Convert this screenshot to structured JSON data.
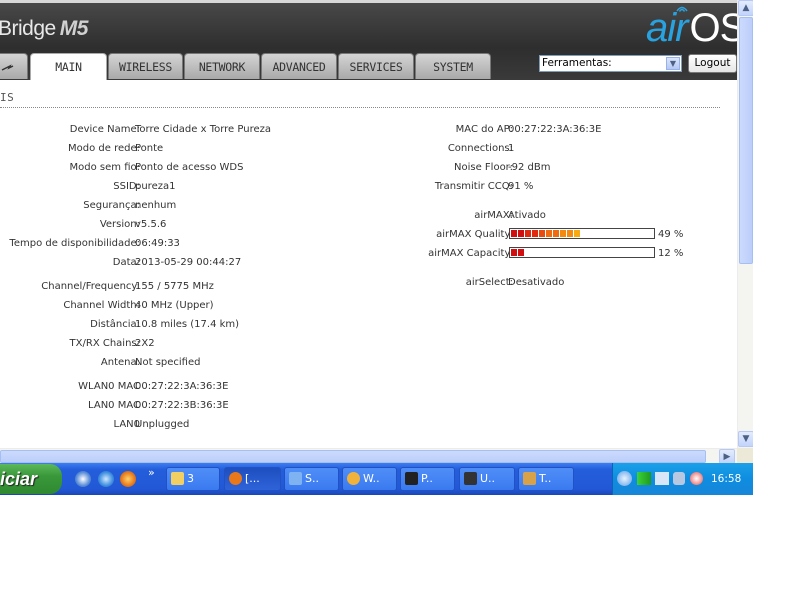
{
  "header": {
    "product_name": "Bridge",
    "product_model": "M5",
    "logo_air": "air",
    "logo_os": "OS"
  },
  "tabs": [
    {
      "label": "MAIN",
      "active": true
    },
    {
      "label": "WIRELESS"
    },
    {
      "label": "NETWORK"
    },
    {
      "label": "ADVANCED"
    },
    {
      "label": "SERVICES"
    },
    {
      "label": "SYSTEM"
    }
  ],
  "toolbar": {
    "tools_selected": "Ferramentas:",
    "logout_label": "Logout"
  },
  "section": {
    "title": "IS"
  },
  "status_left": [
    {
      "label": "Device Name:",
      "value": "Torre Cidade x Torre Pureza"
    },
    {
      "label": "Modo de rede:",
      "value": "Ponte"
    },
    {
      "label": "Modo sem fio:",
      "value": "Ponto de acesso WDS"
    },
    {
      "label": "SSID:",
      "value": "pureza1"
    },
    {
      "label": "Segurança:",
      "value": "nenhum"
    },
    {
      "label": "Version:",
      "value": "v5.5.6"
    },
    {
      "label": "Tempo de disponibilidade:",
      "value": "06:49:33"
    },
    {
      "label": "Data:",
      "value": "2013-05-29 00:44:27"
    },
    {
      "label": "Channel/Frequency:",
      "value": "155 / 5775 MHz"
    },
    {
      "label": "Channel Width:",
      "value": "40 MHz (Upper)"
    },
    {
      "label": "Distância:",
      "value": "10.8 miles (17.4 km)"
    },
    {
      "label": "TX/RX Chains:",
      "value": "2X2"
    },
    {
      "label": "Antena:",
      "value": "Not specified"
    },
    {
      "label": "WLAN0 MAC",
      "value": "00:27:22:3A:36:3E"
    },
    {
      "label": "LAN0 MAC",
      "value": "00:27:22:3B:36:3E"
    },
    {
      "label": "LAN0",
      "value": "Unplugged"
    }
  ],
  "status_right": [
    {
      "label": "MAC do AP:",
      "value": "00:27:22:3A:36:3E"
    },
    {
      "label": "Connections:",
      "value": "1"
    },
    {
      "label": "Noise Floor:",
      "value": "-92 dBm"
    },
    {
      "label": "Transmitir CCQ:",
      "value": "91 %"
    },
    {
      "label": "airMAX:",
      "value": "Ativado"
    },
    {
      "label": "airSelect:",
      "value": "Desativado"
    }
  ],
  "airmax_quality": {
    "label": "airMAX Quality:",
    "percent_text": "49 %",
    "percent": 49
  },
  "airmax_capacity": {
    "label": "airMAX Capacity:",
    "percent_text": "12 %",
    "percent": 12
  },
  "taskbar": {
    "start_label": "iciar",
    "overflow_chevron": "»",
    "tasks": [
      {
        "label": "3",
        "icon": "folder-icon"
      },
      {
        "label": "[...",
        "icon": "firefox-icon",
        "active": true
      },
      {
        "label": "S..",
        "icon": "document-icon"
      },
      {
        "label": "W..",
        "icon": "media-icon"
      },
      {
        "label": "P..",
        "icon": "console-icon"
      },
      {
        "label": "U..",
        "icon": "terminal-icon"
      },
      {
        "label": "T..",
        "icon": "app-icon"
      }
    ],
    "clock": "16:58"
  },
  "colors": {
    "header_bg": "#3a3a3a",
    "logo_blue": "#29a3e0",
    "taskbar_blue": "#245edb",
    "start_green": "#3a973a"
  }
}
